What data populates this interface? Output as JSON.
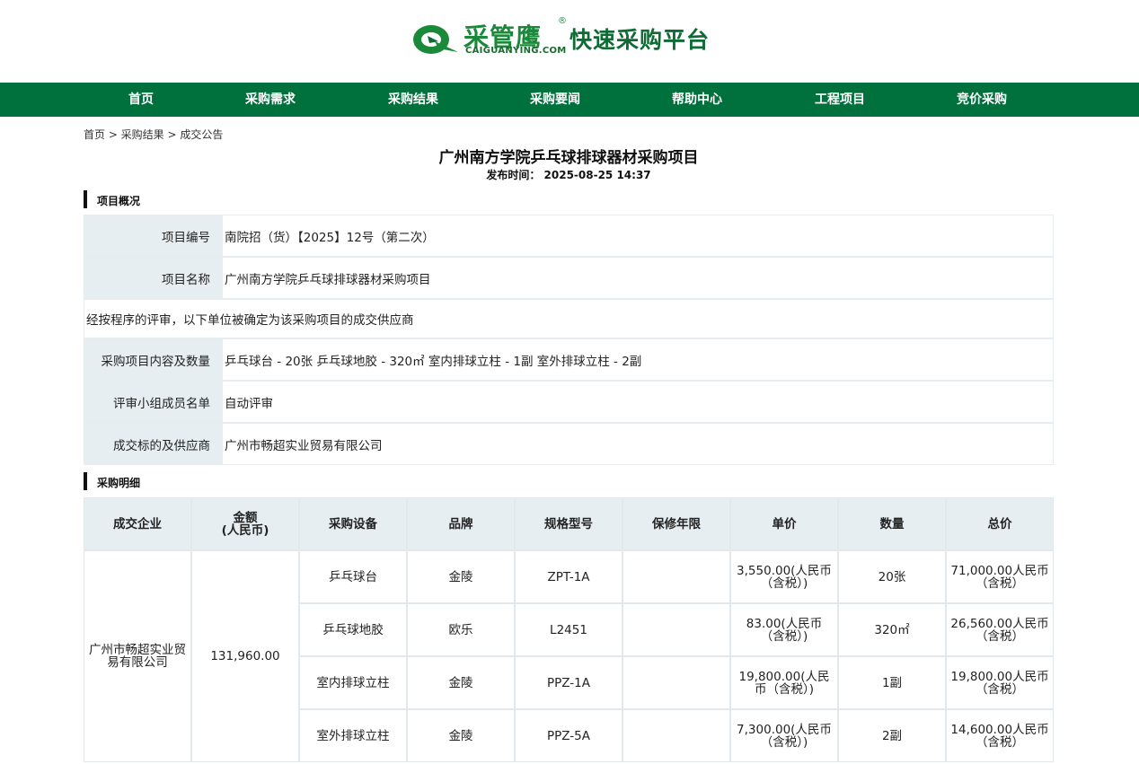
{
  "header": {
    "brand": "采管鹰",
    "registered": "®",
    "domain": "CAIGUANYING.COM",
    "slogan": "快速采购平台",
    "colors": {
      "brand_green": "#1a8a3a",
      "nav_green": "#00703c"
    }
  },
  "nav": {
    "items": [
      {
        "label": "首页"
      },
      {
        "label": "采购需求"
      },
      {
        "label": "采购结果"
      },
      {
        "label": "采购要闻"
      },
      {
        "label": "帮助中心"
      },
      {
        "label": "工程项目"
      },
      {
        "label": "竞价采购"
      }
    ]
  },
  "breadcrumb": {
    "text": "首页 > 采购结果 > 成交公告"
  },
  "article": {
    "title": "广州南方学院乒乓球排球器材采购项目",
    "pubtime": "发布时间： 2025-08-25 14:37"
  },
  "overview": {
    "heading": "项目概况",
    "project_no_key": "项目编号",
    "project_no_val": "南院招（货）【2025】12号（第二次）",
    "project_name_key": "项目名称",
    "project_name_val": "广州南方学院乒乓球排球器材采购项目",
    "statement": "经按程序的评审，以下单位被确定为该采购项目的成交供应商",
    "content_key": "采购项目内容及数量",
    "content_val": "乒乓球台 - 20张 乒乓球地胶 - 320㎡ 室内排球立柱 - 1副 室外排球立柱 - 2副",
    "panel_key": "评审小组成员名单",
    "panel_val": "自动评审",
    "winner_key": "成交标的及供应商",
    "winner_val": "广州市畅超实业贸易有限公司"
  },
  "detail": {
    "heading": "采购明细",
    "headers": {
      "company": "成交企业",
      "amount_l1": "金额",
      "amount_l2": "(人民币)",
      "equipment": "采购设备",
      "brand": "品牌",
      "model": "规格型号",
      "warranty": "保修年限",
      "unit_price": "单价",
      "qty": "数量",
      "total": "总价"
    },
    "company": "广州市畅超实业贸易有限公司",
    "amount": "131,960.00",
    "rows": [
      {
        "equipment": "乒乓球台",
        "brand": "金陵",
        "model": "ZPT-1A",
        "warranty": "",
        "unit_price": "3,550.00(人民币（含税）)",
        "qty": "20张",
        "total": "71,000.00人民币（含税）"
      },
      {
        "equipment": "乒乓球地胶",
        "brand": "欧乐",
        "model": "L2451",
        "warranty": "",
        "unit_price": "83.00(人民币（含税）)",
        "qty": "320㎡",
        "total": "26,560.00人民币（含税）"
      },
      {
        "equipment": "室内排球立柱",
        "brand": "金陵",
        "model": "PPZ-1A",
        "warranty": "",
        "unit_price": "19,800.00(人民币（含税）)",
        "qty": "1副",
        "total": "19,800.00人民币（含税）"
      },
      {
        "equipment": "室外排球立柱",
        "brand": "金陵",
        "model": "PPZ-5A",
        "warranty": "",
        "unit_price": "7,300.00(人民币（含税）)",
        "qty": "2副",
        "total": "14,600.00人民币（含税）"
      }
    ]
  }
}
